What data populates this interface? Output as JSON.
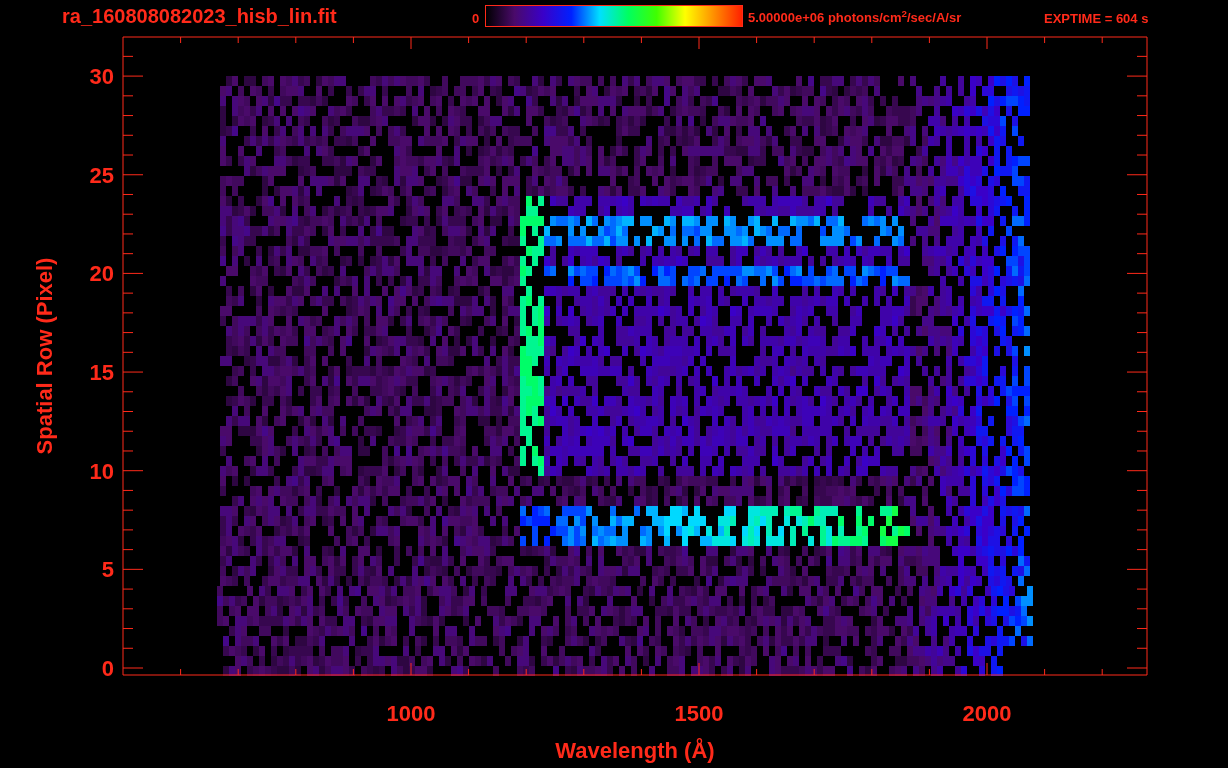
{
  "title": "ra_160808082023_hisb_lin.fit",
  "colorbar": {
    "min_label": "0",
    "max_label": "5.00000e+06 photons/cm$^{2}$/sec/A/sr"
  },
  "exptime": "EXPTIME = 604 s",
  "plot": {
    "xlabel": "Wavelength (Å)",
    "ylabel": "Spatial Row (Pixel)",
    "xticks": [
      "1000",
      "1500",
      "2000"
    ],
    "yticks": [
      "30",
      "25",
      "20",
      "15",
      "10",
      "5",
      "0"
    ]
  }
}
